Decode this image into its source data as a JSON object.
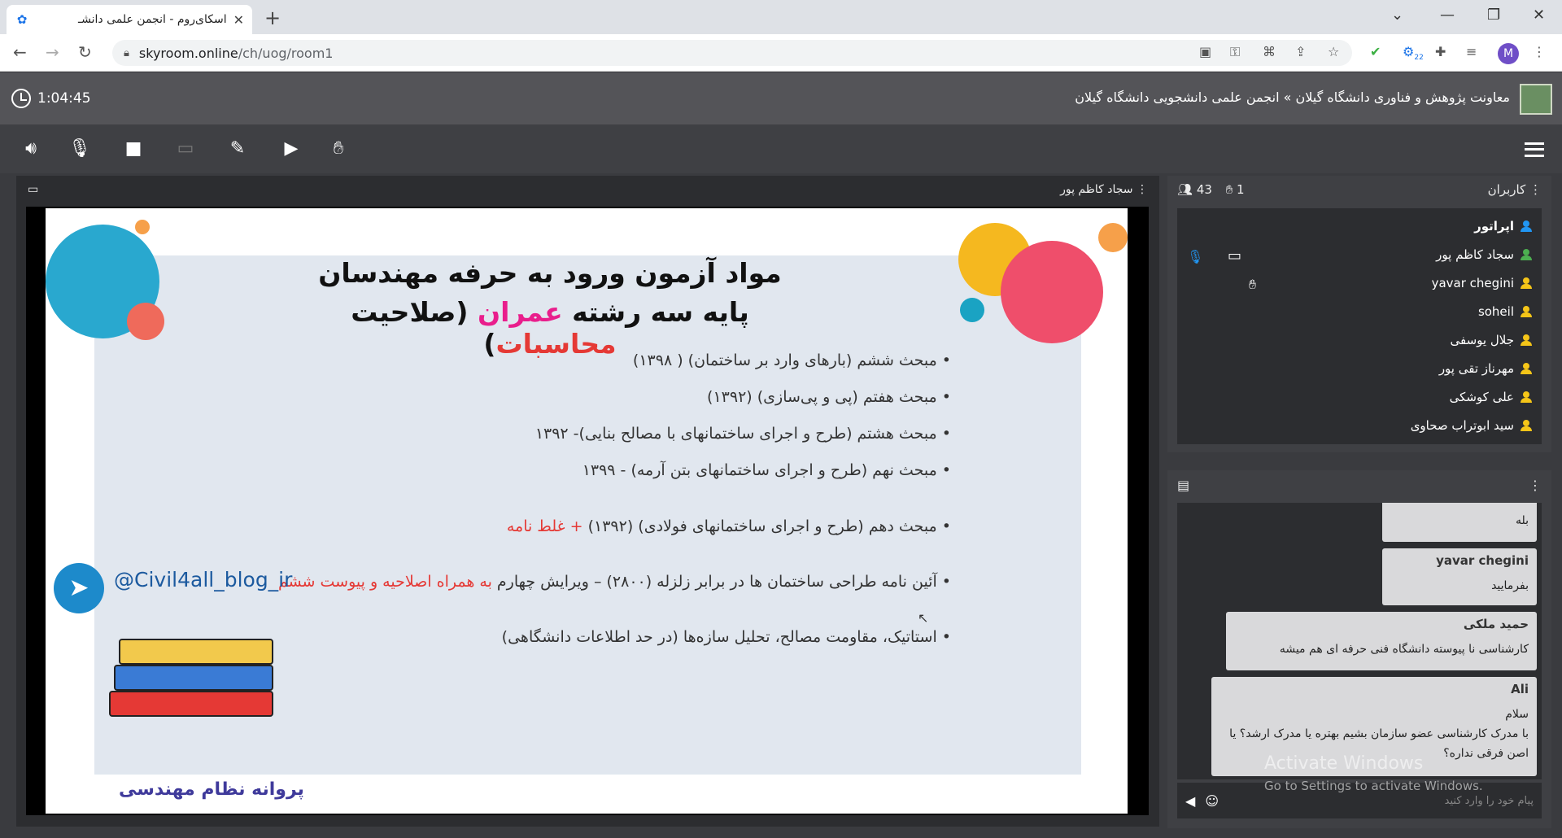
{
  "browser": {
    "tab_title": "اسکای‌روم - انجمن علمی دانشـ",
    "new_tab": "+",
    "url_host": "skyroom.online",
    "url_path": "/ch/uog/room1",
    "profile_initial": "M",
    "extension_badge": "22"
  },
  "header": {
    "timer": "1:04:45",
    "breadcrumb": "معاونت پژوهش و فناوری دانشگاه گیلان » انجمن علمی دانشجویی دانشگاه گیلان"
  },
  "stage": {
    "presenter": "سجاد کاظم پور",
    "slide": {
      "title_line1": "مواد آزمون ورود به حرفه مهندسان",
      "title_line2_a": "پایه سه رشته ",
      "title_line2_b": "عمران",
      "title_line2_c": " (صلاحیت ",
      "title_line2_d": "محاسبات",
      "title_line2_e": ")",
      "bullets": [
        "مبحث ششم (بارهای وارد بر ساختمان) ( ۱۳۹۸)",
        "مبحث هفتم (پی و پی‌سازی) (۱۳۹۲)",
        "مبحث هشتم (طرح و اجرای ساختمانهای با مصالح بنایی)- ۱۳۹۲",
        "مبحث نهم (طرح و اجرای ساختمانهای بتن آرمه) - ۱۳۹۹"
      ],
      "bullet5_main": "مبحث دهم (طرح و اجرای ساختمانهای فولادی) (۱۳۹۲)",
      "bullet5_red": " + غلط نامه",
      "bullet6_main": "آئین نامه طراحی ساختمان ها در برابر زلزله (۲۸۰۰) – ویرایش چهارم",
      "bullet6_red": " به همراه اصلاحیه و پیوست ششم",
      "note": "استاتیک، مقاومت مصالح، تحلیل سازه‌ها (در حد اطلاعات دانشگاهی)",
      "handle": "@Civil4all_blog_ir",
      "caption": "پروانه نظام مهندسی"
    }
  },
  "users": {
    "title": "کاربران",
    "count": "43",
    "hands": "1",
    "list": [
      {
        "name": "اپراتور",
        "color": "#2196f3",
        "bold": true
      },
      {
        "name": "سجاد کاظم پور",
        "color": "#4caf50"
      },
      {
        "name": "yavar chegini",
        "color": "#f5c518"
      },
      {
        "name": "soheil",
        "color": "#f5c518"
      },
      {
        "name": "جلال یوسفی",
        "color": "#f5c518"
      },
      {
        "name": "مهرناز تقی پور",
        "color": "#f5c518"
      },
      {
        "name": "علی کوشکی",
        "color": "#f5c518"
      },
      {
        "name": "سید ابوتراب صحاوی",
        "color": "#f5c518"
      }
    ]
  },
  "chat": {
    "messages": [
      {
        "name": "",
        "body": "بله"
      },
      {
        "name": "yavar chegini",
        "body": "بفرمایید"
      },
      {
        "name": "حمید ملکی",
        "body": "کارشناسی نا پیوسته دانشگاه فنی حرفه ای هم میشه"
      },
      {
        "name": "Ali",
        "body": "سلام\nبا مدرک کارشناسی عضو سازمان بشیم بهتره یا مدرک ارشد؟ یا اصن فرقی نداره؟"
      }
    ],
    "placeholder": "پیام خود را وارد کنید",
    "watermark1": "Activate Windows",
    "watermark2": "Go to Settings to activate Windows."
  }
}
